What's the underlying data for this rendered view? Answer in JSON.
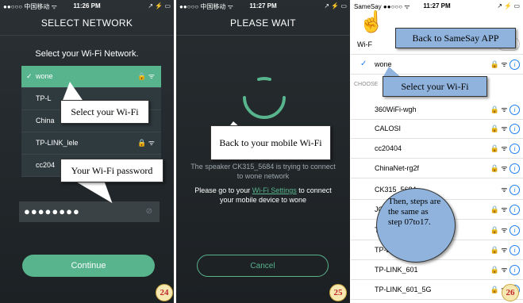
{
  "panel1": {
    "status": {
      "carrier": "●●○○○ 中国移动 ᯤ",
      "time": "11:26 PM",
      "battery": "↗ ⚡ ▭"
    },
    "title": "SELECT NETWORK",
    "subtitle": "Select your Wi-Fi Network.",
    "networks": [
      {
        "name": "wone",
        "selected": true,
        "icons": "🔒 ᯤ"
      },
      {
        "name": "TP-L",
        "selected": false,
        "icons": ""
      },
      {
        "name": "China",
        "selected": false,
        "icons": ""
      },
      {
        "name": "TP-LINK_lele",
        "selected": false,
        "icons": "🔒 ᯤ"
      },
      {
        "name": "cc204",
        "selected": false,
        "icons": ""
      }
    ],
    "password_mask": "●●●●●●●●",
    "continue_label": "Continue",
    "callout_select": "Select your Wi-Fi",
    "callout_password": "Your Wi-Fi password",
    "page_number": "24"
  },
  "panel2": {
    "status": {
      "carrier": "●●○○○ 中国移动 ᯤ",
      "time": "11:27 PM",
      "battery": "↗ ⚡ ▭"
    },
    "title": "PLEASE WAIT",
    "info_line": "The speaker CK315_5684 is trying to connect to wone network",
    "goto_prefix": "Please go to your ",
    "goto_link": "Wi-Fi Settings",
    "goto_suffix": " to connect your mobile device to wone",
    "cancel_label": "Cancel",
    "callout_back": "Back to your mobile Wi-Fi",
    "page_number": "25"
  },
  "panel3": {
    "status": {
      "carrier": "SameSay ●●○○○ ᯤ",
      "time": "11:27 PM",
      "battery": "↗ ⚡ ▭"
    },
    "first_row": "Wi-F",
    "connected": "wone",
    "section_label": "CHOOSE",
    "networks": [
      {
        "name": "360WiFi-wgh",
        "lock": true,
        "info": "i"
      },
      {
        "name": "CALOSI",
        "lock": true,
        "info": "i"
      },
      {
        "name": "cc20404",
        "lock": true,
        "info": "i"
      },
      {
        "name": "ChinaNet-rg2f",
        "lock": true,
        "info": "i"
      },
      {
        "name": "CK315_5684",
        "lock": false,
        "info": "i"
      },
      {
        "name": "JCC",
        "lock": true,
        "info": "i"
      },
      {
        "name": "Top",
        "lock": true,
        "info": "i"
      },
      {
        "name": "TP-LINK_47",
        "lock": true,
        "info": "i"
      },
      {
        "name": "TP-LINK_601",
        "lock": true,
        "info": "i"
      },
      {
        "name": "TP-LINK_601_5G",
        "lock": true,
        "info": "i"
      }
    ],
    "callout_back_app": "Back to SameSay APP",
    "callout_select": "Select your Wi-Fi",
    "callout_steps": "Then, steps are the same as step 07to17.",
    "page_number": "26"
  }
}
